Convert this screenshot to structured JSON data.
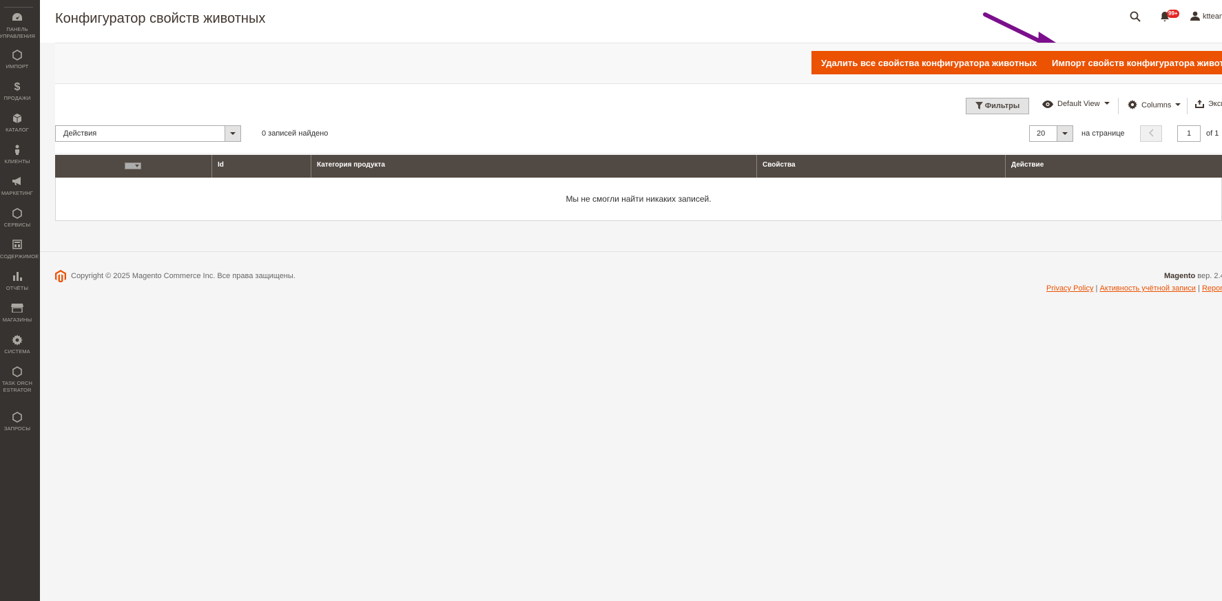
{
  "sidebar": {
    "items": [
      {
        "label": "ПАНЕЛЬ УПРАВЛЕНИЯ",
        "icon": "dashboard-icon"
      },
      {
        "label": "ИМПОРТ",
        "icon": "hexagon-icon"
      },
      {
        "label": "ПРОДАЖИ",
        "icon": "dollar-icon"
      },
      {
        "label": "КАТАЛОГ",
        "icon": "box-icon"
      },
      {
        "label": "КЛИЕНТЫ",
        "icon": "person-icon"
      },
      {
        "label": "МАРКЕТИНГ",
        "icon": "megaphone-icon"
      },
      {
        "label": "СЕРВИСЫ",
        "icon": "hexagon-icon"
      },
      {
        "label": "СОДЕРЖИМОЕ",
        "icon": "layout-icon"
      },
      {
        "label": "ОТЧЁТЫ",
        "icon": "bar-chart-icon"
      },
      {
        "label": "МАГАЗИНЫ",
        "icon": "store-icon"
      },
      {
        "label": "СИСТЕМА",
        "icon": "gear-icon"
      },
      {
        "label": "TASK ORCHESTRATOR",
        "icon": "hexagon-icon"
      },
      {
        "label": "ЗАПРОСЫ",
        "icon": "hexagon-icon"
      }
    ]
  },
  "header": {
    "title": "Конфигуратор свойств животных",
    "notification_count": "99+",
    "username": "ktteam"
  },
  "actions": {
    "delete_all": "Удалить все свойства конфигуратора животных",
    "import": "Импорт свойств конфигуратора животных"
  },
  "toolbar": {
    "filters": "Фильтры",
    "view": "Default View",
    "columns": "Columns",
    "export": "Экспорт",
    "mass_action": "Действия",
    "records_found": "0 записей найдено",
    "per_page_value": "20",
    "per_page_label": "на странице",
    "page_current": "1",
    "page_of": "of 1"
  },
  "grid": {
    "columns": [
      "Id",
      "Категория продукта",
      "Свойства",
      "Действие"
    ],
    "empty_message": "Мы не смогли найти никаких записей."
  },
  "footer": {
    "copyright": "Copyright © 2025 Magento Commerce Inc. Все права защищены.",
    "brand": "Magento",
    "version": "вер. 2.4",
    "links": [
      "Privacy Policy",
      "Активность учётной записи",
      "Report"
    ]
  },
  "colors": {
    "sidebar_bg": "#373330",
    "accent": "#eb5202",
    "grid_header": "#514943",
    "annotation": "#7b0f8c"
  }
}
